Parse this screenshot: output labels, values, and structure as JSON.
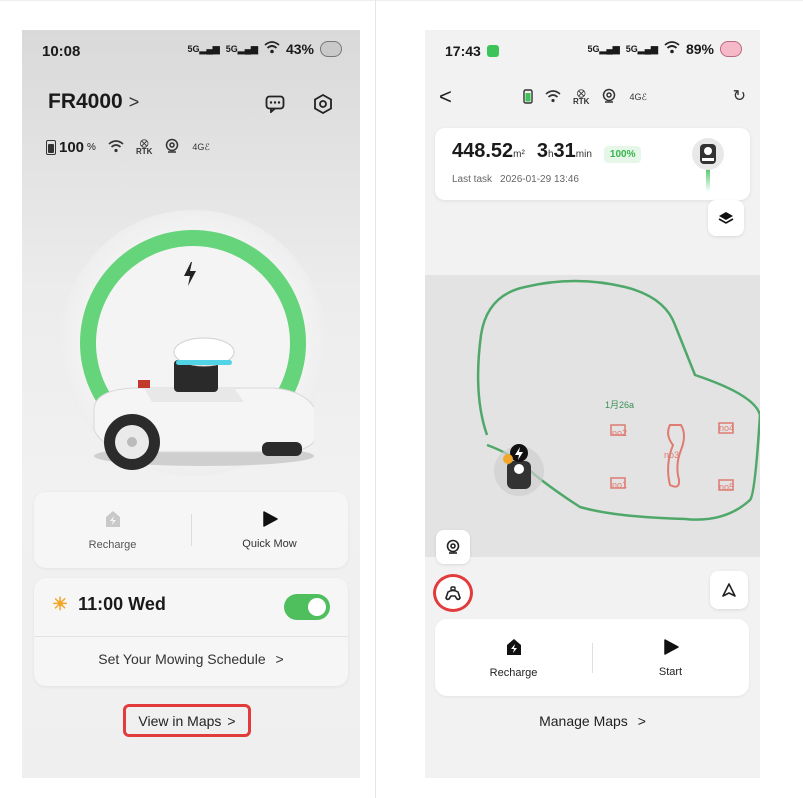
{
  "left": {
    "status": {
      "time": "10:08",
      "signal1": "5G",
      "signal2": "5G",
      "battery": "43%"
    },
    "device": {
      "name": "FR4000",
      "chevron": ">"
    },
    "stats": {
      "battery_value": "100",
      "battery_unit": "%",
      "rtk": "RTK",
      "lte": "4G"
    },
    "actions": {
      "recharge_label": "Recharge",
      "quickmow_label": "Quick Mow"
    },
    "schedule": {
      "time_day": "11:00 Wed",
      "enabled": true,
      "link_label": "Set Your Mowing Schedule",
      "link_chevron": ">"
    },
    "view_maps": {
      "label": "View in Maps",
      "chevron": ">"
    },
    "colors": {
      "ring": "#66d47a",
      "toggle": "#4fbf5e",
      "highlight": "#e23b3b",
      "sun": "#f2a72a"
    }
  },
  "right": {
    "status": {
      "time": "17:43",
      "signal1": "5G",
      "signal2": "5G",
      "battery": "89%"
    },
    "nav": {
      "back": "<",
      "rtk": "RTK",
      "lte": "4G"
    },
    "task": {
      "area_value": "448.52",
      "area_unit": "m²",
      "hours_value": "3",
      "hours_unit": "h",
      "minutes_value": "31",
      "minutes_unit": "min",
      "completion": "100%",
      "last_label": "Last task",
      "last_time": "2026-01-29 13:46"
    },
    "map": {
      "zone_name": "1月26a",
      "no_go_zones": [
        "no2",
        "no3",
        "no4",
        "no1",
        "no5"
      ],
      "boundary_color": "#4fa86a",
      "no_go_color": "#e07b72"
    },
    "actions": {
      "recharge_label": "Recharge",
      "start_label": "Start"
    },
    "manage_maps": {
      "label": "Manage Maps",
      "chevron": ">"
    }
  }
}
